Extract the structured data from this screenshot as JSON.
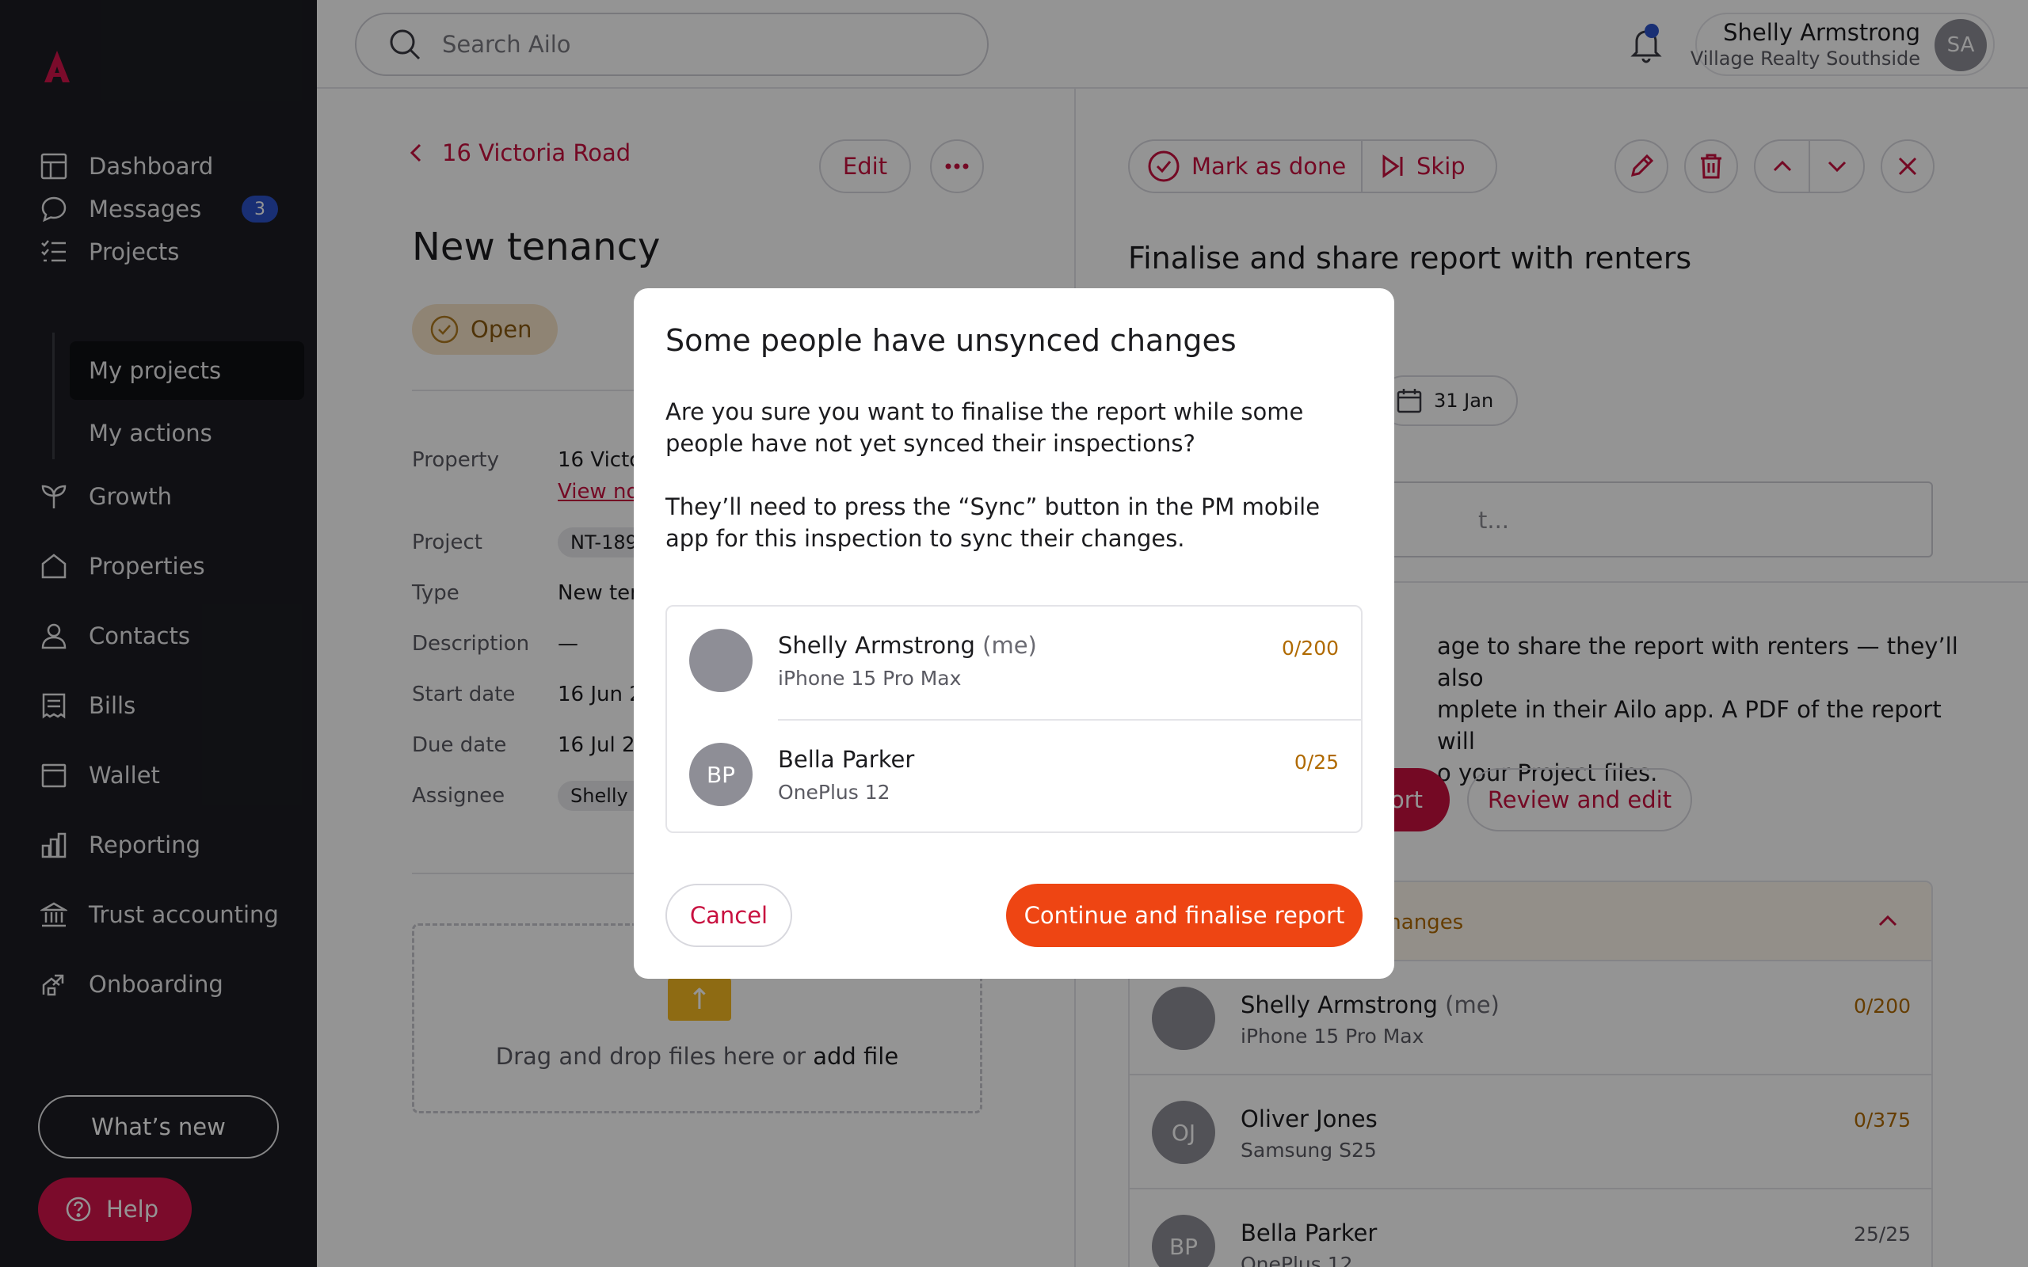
{
  "colors": {
    "sidebar_bg": "#1c1d23",
    "brand_red": "#c8103f",
    "accent_orange": "#ee4513",
    "badge_blue": "#2b52c9",
    "warning_amber": "#b06a00"
  },
  "sidebar": {
    "logo_icon": "ailo-logo-icon",
    "items": [
      {
        "label": "Dashboard",
        "icon": "dashboard-icon"
      },
      {
        "label": "Messages",
        "icon": "message-bubble-icon",
        "badge": "3"
      },
      {
        "label": "Projects",
        "icon": "checklist-icon"
      },
      {
        "label": "Growth",
        "icon": "sprout-icon"
      },
      {
        "label": "Properties",
        "icon": "house-icon"
      },
      {
        "label": "Contacts",
        "icon": "person-icon"
      },
      {
        "label": "Bills",
        "icon": "receipt-icon"
      },
      {
        "label": "Wallet",
        "icon": "wallet-icon"
      },
      {
        "label": "Reporting",
        "icon": "bar-chart-icon"
      },
      {
        "label": "Trust accounting",
        "icon": "bank-icon"
      },
      {
        "label": "Onboarding",
        "icon": "onboarding-icon"
      }
    ],
    "sub_items": [
      {
        "label": "My projects",
        "active": true
      },
      {
        "label": "My actions",
        "active": false
      }
    ],
    "whats_new": "What’s new",
    "help": "Help"
  },
  "topbar": {
    "search_placeholder": "Search Ailo",
    "user_name": "Shelly Armstrong",
    "user_org": "Village Realty Southside",
    "user_initials": "SA"
  },
  "project": {
    "back_label": "16 Victoria Road",
    "edit_label": "Edit",
    "title": "New tenancy",
    "status": "Open",
    "fields": [
      {
        "label": "Property",
        "value": "16 Victor",
        "link": "View no"
      },
      {
        "label": "Project",
        "chip": "NT-189"
      },
      {
        "label": "Type",
        "value": "New ten"
      },
      {
        "label": "Description",
        "value": "—"
      },
      {
        "label": "Start date",
        "value": "16 Jun 2"
      },
      {
        "label": "Due date",
        "value": "16 Jul 20"
      },
      {
        "label": "Assignee",
        "chip": "Shelly A"
      }
    ],
    "drop_text_prefix": "Drag and drop files here or ",
    "drop_text_link": "add file"
  },
  "task": {
    "mark_done": "Mark as done",
    "skip": "Skip",
    "title": "Finalise and share report with renters",
    "due_date": "31 Jan",
    "comment_placeholder_tail": "t...",
    "description": "age to share the report with renters — they’ll also\nmplete in their Ailo app. A PDF of the report will\no your Project files.",
    "primary_action_tail": "ort",
    "review_edit": "Review and edit",
    "sync_header_tail": "changes",
    "people": [
      {
        "name": "Shelly Armstrong",
        "me": "(me)",
        "device": "iPhone 15 Pro Max",
        "count": "0/200",
        "photo": true
      },
      {
        "name": "Oliver Jones",
        "initials": "OJ",
        "device": "Samsung S25",
        "count": "0/375"
      },
      {
        "name": "Bella Parker",
        "initials": "BP",
        "device": "OnePlus 12",
        "count": "25/25"
      }
    ]
  },
  "modal": {
    "title": "Some people have unsynced changes",
    "para1": "Are you sure you want to finalise the report while some people have not yet synced their inspections?",
    "para2": "They’ll need to press the “Sync” button in the PM mobile app for this inspection to sync their changes.",
    "people": [
      {
        "name": "Shelly Armstrong",
        "me": "(me)",
        "device": "iPhone 15 Pro Max",
        "count": "0/200"
      },
      {
        "name": "Bella Parker",
        "initials": "BP",
        "device": "OnePlus 12",
        "count": "0/25"
      }
    ],
    "cancel": "Cancel",
    "continue": "Continue and finalise report"
  }
}
